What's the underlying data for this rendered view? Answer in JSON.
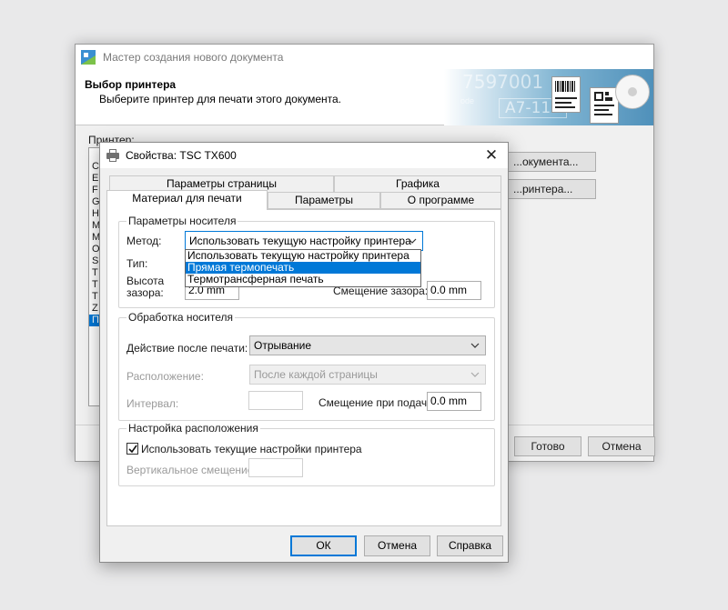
{
  "wizard": {
    "title": "Мастер создания нового документа",
    "header_title": "Выбор принтера",
    "header_subtitle": "Выберите принтер для печати этого документа.",
    "banner": {
      "num_top": "7597001",
      "num_bottom": "A7-118",
      "small_text": "ode"
    },
    "printer_label": "Принтер:",
    "printer_list": [
      "C",
      "E",
      "F",
      "G",
      "H",
      "M",
      "M",
      "O",
      "S",
      "T",
      "T",
      "T",
      "Z",
      "П"
    ],
    "selected_index": 13,
    "buttons": {
      "properties_doc": "...окумента...",
      "properties_printer": "...ринтера...",
      "finish": "Готово",
      "cancel": "Отмена"
    }
  },
  "dialog": {
    "title": "Свойства: TSC TX600",
    "tabs_back": [
      "Параметры страницы",
      "Графика"
    ],
    "tabs_front": [
      "Материал для печати",
      "Параметры",
      "О программе"
    ],
    "media_params": {
      "title": "Параметры носителя",
      "method_label": "Метод:",
      "method_value": "Использовать текущую настройку принтера",
      "method_options": [
        "Использовать текущую настройку принтера",
        "Прямая термопечать",
        "Термотрансферная печать"
      ],
      "highlighted_option": 1,
      "type_label": "Тип:",
      "gap_label_1": "Высота",
      "gap_label_2": "зазора:",
      "gap_value": "2.0 mm",
      "offset_label": "Смещение зазора:",
      "offset_value": "0.0 mm"
    },
    "media_handling": {
      "title": "Обработка носителя",
      "action_label": "Действие после печати:",
      "action_value": "Отрывание",
      "location_label": "Расположение:",
      "location_value": "После каждой страницы",
      "interval_label": "Интервал:",
      "interval_value": "",
      "feed_offset_label": "Смещение при подаче:",
      "feed_offset_value": "0.0 mm"
    },
    "position_settings": {
      "title": "Настройка расположения",
      "use_printer_label": "Использовать текущие настройки принтера",
      "use_printer_checked": true,
      "vertical_offset_label": "Вертикальное смещение:",
      "vertical_offset_value": ""
    },
    "buttons": {
      "ok": "ОК",
      "cancel": "Отмена",
      "help": "Справка"
    }
  },
  "colors": {
    "accent": "#0078d7",
    "window_bg": "#f0f0f0"
  }
}
